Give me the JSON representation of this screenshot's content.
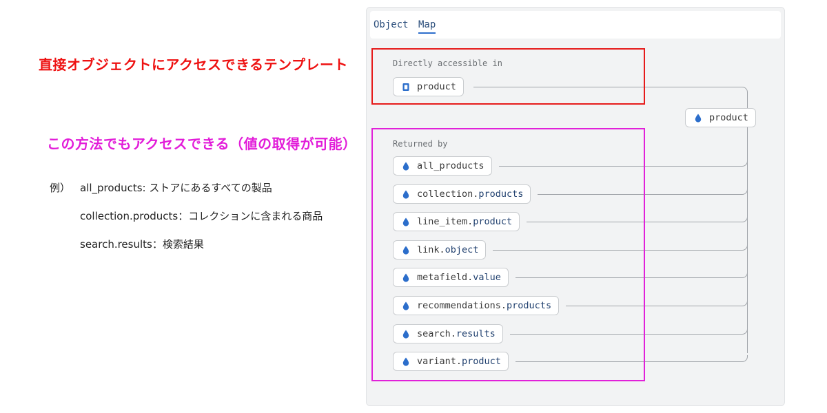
{
  "annotations": {
    "direct_access": "直接オブジェクトにアクセスできるテンプレート",
    "returned_by_note": "この方法でもアクセスできる（値の取得が可能）",
    "example_label": "例）",
    "examples": [
      "all_products: ストアにあるすべての製品",
      "collection.products：コレクションに含まれる商品",
      "search.results：検索結果"
    ]
  },
  "tabs": [
    {
      "label": "Object",
      "active": false
    },
    {
      "label": "Map",
      "active": true
    }
  ],
  "direct": {
    "label": "Directly accessible in",
    "item": "product",
    "icon": "template-file-icon"
  },
  "target": {
    "label": "product",
    "icon": "drop-icon"
  },
  "returned_by": {
    "label": "Returned by",
    "items": [
      {
        "main": "all_products",
        "suffix": ""
      },
      {
        "main": "collection.",
        "suffix": "products"
      },
      {
        "main": "line_item.",
        "suffix": "product"
      },
      {
        "main": "link.",
        "suffix": "object"
      },
      {
        "main": "metafield.",
        "suffix": "value"
      },
      {
        "main": "recommendations.",
        "suffix": "products"
      },
      {
        "main": "search.",
        "suffix": "results"
      },
      {
        "main": "variant.",
        "suffix": "product"
      }
    ]
  },
  "colors": {
    "highlight_red": "#e61a1a",
    "highlight_magenta": "#e121d9",
    "drop_icon": "#2c6ecb",
    "tab_text": "#2c4f7c"
  }
}
